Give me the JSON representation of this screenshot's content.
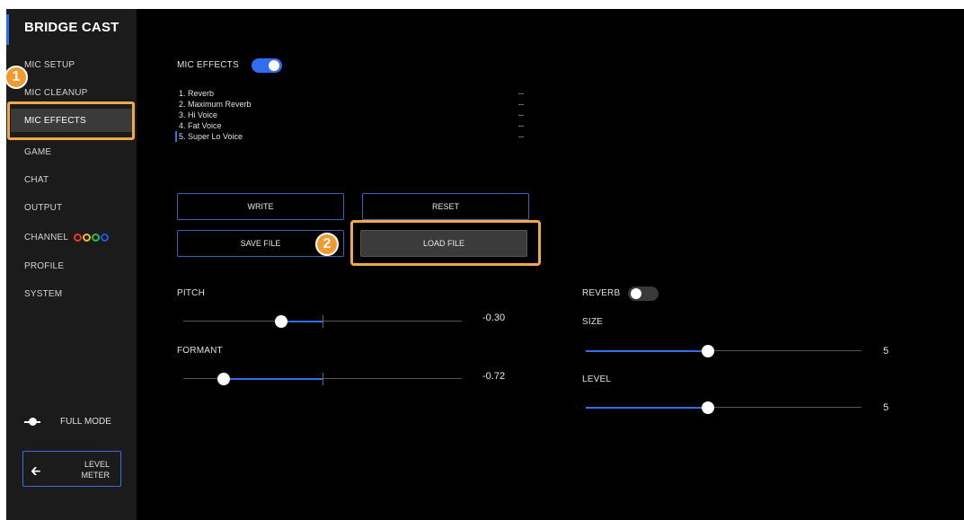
{
  "app": {
    "title": "BRIDGE CAST"
  },
  "sidebar": {
    "items": [
      {
        "label": "MIC SETUP"
      },
      {
        "label": "MIC CLEANUP"
      },
      {
        "label": "MIC EFFECTS"
      },
      {
        "label": "GAME"
      },
      {
        "label": "CHAT"
      },
      {
        "label": "OUTPUT"
      },
      {
        "label": "CHANNEL"
      },
      {
        "label": "PROFILE"
      },
      {
        "label": "SYSTEM"
      }
    ],
    "channel_colors": [
      "#e53935",
      "#f2c01e",
      "#22c055",
      "#2a50e0"
    ],
    "full_mode_label": "FULL MODE",
    "level_meter_line1": "LEVEL",
    "level_meter_line2": "METER"
  },
  "callouts": {
    "one": "1",
    "two": "2"
  },
  "mic_effects": {
    "label": "MIC EFFECTS",
    "enabled": true,
    "presets": [
      {
        "label": "1. Reverb",
        "value": "--"
      },
      {
        "label": "2. Maximum Reverb",
        "value": "--"
      },
      {
        "label": "3. Hi Voice",
        "value": "--"
      },
      {
        "label": "4. Fat Voice",
        "value": "--"
      },
      {
        "label": "5. Super Lo Voice",
        "value": "--"
      }
    ],
    "selected_preset": 5
  },
  "buttons": {
    "write": "WRITE",
    "reset": "RESET",
    "save_file": "SAVE FILE",
    "load_file": "LOAD FILE"
  },
  "pitch": {
    "label": "PITCH",
    "value": "-0.30"
  },
  "formant": {
    "label": "FORMANT",
    "value": "-0.72"
  },
  "reverb": {
    "label": "REVERB",
    "enabled": false,
    "size": {
      "label": "SIZE",
      "value": "5"
    },
    "level": {
      "label": "LEVEL",
      "value": "5"
    }
  },
  "colors": {
    "accent": "#2f6ef0",
    "highlight": "#f0a94a"
  }
}
